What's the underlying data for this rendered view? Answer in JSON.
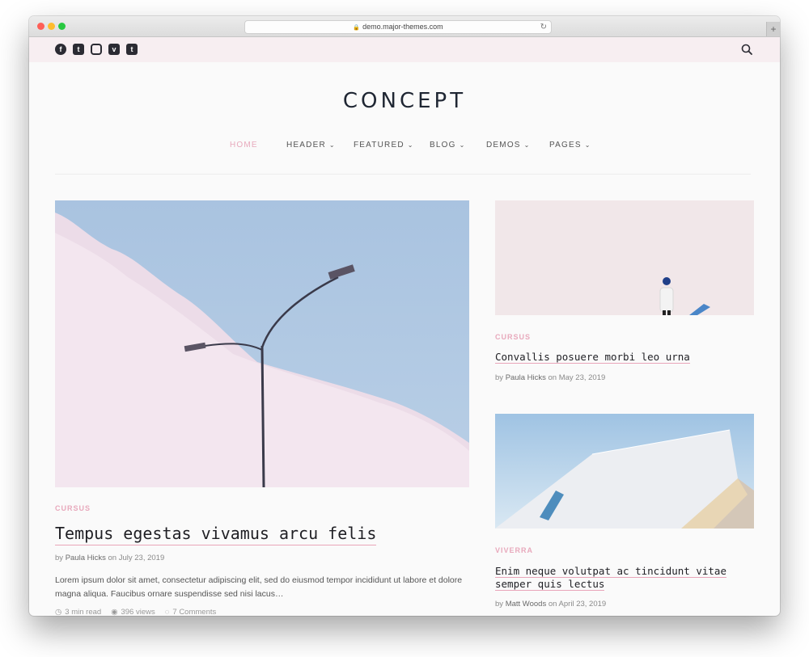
{
  "browser": {
    "url": "demo.major-themes.com",
    "traffic_lights": {
      "close": "#fe5f57",
      "minimize": "#febc2e",
      "zoom": "#28c840"
    },
    "new_tab_label": "+"
  },
  "topbar": {
    "social": [
      {
        "name": "facebook",
        "glyph": "f"
      },
      {
        "name": "twitter",
        "glyph": "t"
      },
      {
        "name": "instagram",
        "glyph": ""
      },
      {
        "name": "vimeo",
        "glyph": "v"
      },
      {
        "name": "tumblr",
        "glyph": "t"
      }
    ]
  },
  "site": {
    "logo": "CONCEPT",
    "accent_color": "#e8a9bc"
  },
  "nav": [
    {
      "label": "HOME",
      "active": true,
      "dropdown": false
    },
    {
      "label": "HEADER",
      "active": false,
      "dropdown": true
    },
    {
      "label": "FEATURED",
      "active": false,
      "dropdown": true
    },
    {
      "label": "BLOG",
      "active": false,
      "dropdown": true
    },
    {
      "label": "DEMOS",
      "active": false,
      "dropdown": true
    },
    {
      "label": "PAGES",
      "active": false,
      "dropdown": true
    }
  ],
  "posts": {
    "main": {
      "category": "CURSUS",
      "title": "Tempus egestas vivamus arcu felis",
      "byline_prefix": "by",
      "author": "Paula Hicks",
      "date_prefix": "on",
      "date": "July 23, 2019",
      "excerpt": "Lorem ipsum dolor sit amet, consectetur adipiscing elit, sed do eiusmod tempor incididunt ut labore et dolore magna aliqua. Faucibus ornare suspendisse sed nisi lacus…",
      "read_time": "3 min read",
      "views": "396 views",
      "comments": "7 Comments"
    },
    "side1": {
      "category": "CURSUS",
      "title": "Convallis posuere morbi leo urna",
      "byline_prefix": "by",
      "author": "Paula Hicks",
      "date_prefix": "on",
      "date": "May 23, 2019"
    },
    "side2": {
      "category": "VIVERRA",
      "title_line1": "Enim neque volutpat ac tincidunt vitae",
      "title_line2": "semper quis lectus",
      "byline_prefix": "by",
      "author": "Matt Woods",
      "date_prefix": "on",
      "date": "April 23, 2019"
    }
  }
}
